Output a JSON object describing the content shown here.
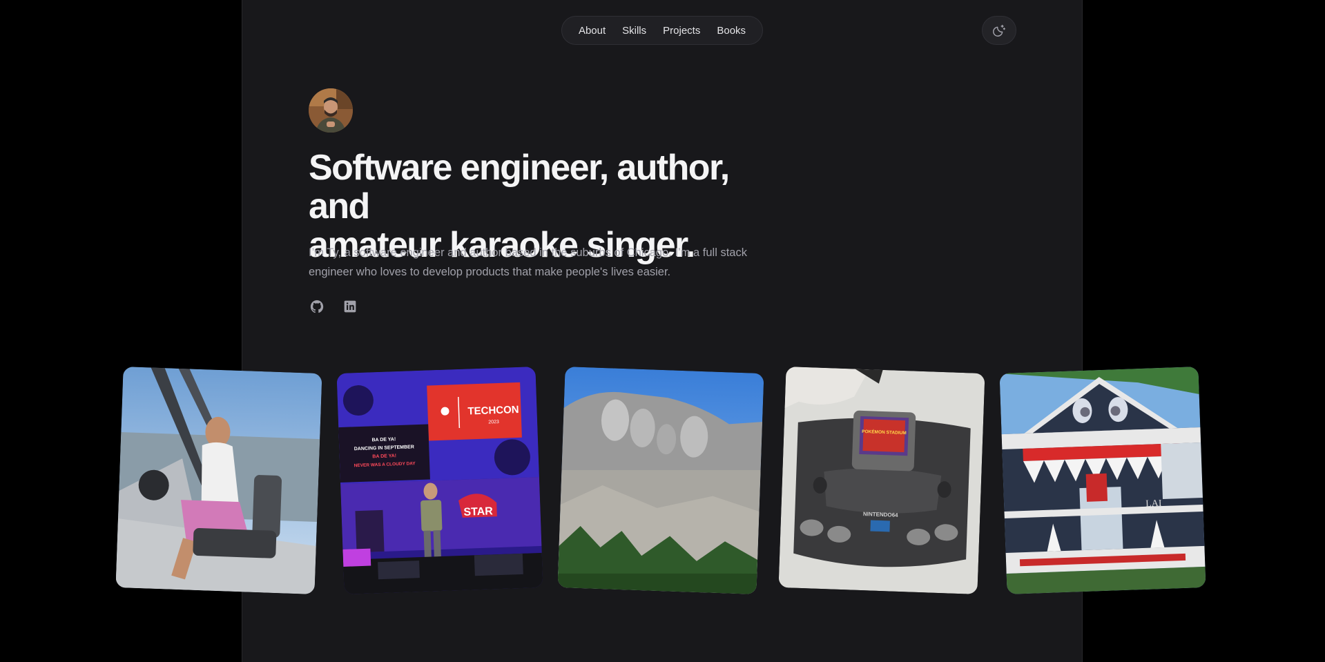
{
  "nav": {
    "items": [
      {
        "label": "About"
      },
      {
        "label": "Skills"
      },
      {
        "label": "Projects"
      },
      {
        "label": "Books"
      }
    ]
  },
  "theme_toggle": {
    "icon": "moon-icon"
  },
  "hero": {
    "headline_line1": "Software engineer, author, and",
    "headline_line2": "amateur karaoke singer.",
    "intro": "I’m Ty, a software engineer and author based in the suburbs of Chicago. I’m a full stack engineer who loves to develop products that make people's lives easier."
  },
  "socials": [
    {
      "icon": "github-icon"
    },
    {
      "icon": "linkedin-icon"
    }
  ],
  "photos": {
    "stage_banner": {
      "title": "TECHCON",
      "year": "2023",
      "lyrics": [
        "BA DE YA!",
        "DANCING IN SEPTEMBER",
        "BA DE YA!",
        "NEVER WAS A CLOUDY DAY"
      ],
      "sign": "STAR"
    },
    "cartridge_label": "POKÉMON STADIUM",
    "console_label": "NINTENDO64"
  },
  "colors": {
    "page_bg": "#000000",
    "panel_bg": "#18181b",
    "heading": "#f4f4f5",
    "body_text": "#a1a1aa"
  }
}
